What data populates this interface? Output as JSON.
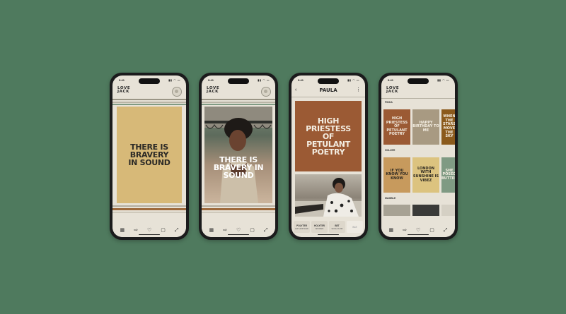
{
  "colors": {
    "background": "#4f7a5e",
    "phone_body": "#1b1b1c",
    "screen_bg": "#e7e2d7",
    "poster_mustard": "#d7b978",
    "poster_brown": "#9b5a34"
  },
  "brand": {
    "logo_line1": "LOVE",
    "logo_line2": "JACK"
  },
  "status": {
    "time": "9:41",
    "icons": "▮▮ ◠ ▭"
  },
  "phone1": {
    "poster_text": "THERE IS BRAVERY IN SOUND"
  },
  "phone2": {
    "poster_text": "THERE IS BRAVERY IN SOUND"
  },
  "phone3": {
    "title": "PAULA",
    "back_icon": "chevron-left-icon",
    "poster_text": "HIGH PRIESTESS OF PETULANT POETRY",
    "tabs": [
      {
        "label": "POLYTER",
        "sub": "HIP HOP RAW"
      },
      {
        "label": "HOLYTER",
        "sub": "SPOKEN"
      },
      {
        "label": "BET",
        "sub": "SOUL FUNK"
      },
      {
        "label": "BLE",
        "sub": ""
      }
    ]
  },
  "phone4": {
    "sections": [
      "PINKA",
      "HOLZER",
      "MAMBLE"
    ],
    "tiles": [
      {
        "text": "HIGH PRIESTESS OF PETULANT POETRY",
        "caption": "PINKA"
      },
      {
        "text": "HAPPY BIRTHDAY TO ME",
        "caption": ""
      },
      {
        "text": "WHEN THE STARS MOVE THE SKY",
        "caption": ""
      },
      {
        "text": "IF YOU KNOW YOU KNOW",
        "caption": "HOLZER"
      },
      {
        "text": "LONDON WITH SUNSHINE IS VIBEZ",
        "caption": ""
      },
      {
        "text": "SHE POSED BUTTER",
        "caption": ""
      }
    ]
  },
  "nav": {
    "icons": [
      "grid-icon",
      "play-icon",
      "heart-icon",
      "chat-icon",
      "expand-icon"
    ],
    "glyphs": [
      "▦",
      "⇨",
      "♡",
      "▢",
      "⤢"
    ]
  }
}
